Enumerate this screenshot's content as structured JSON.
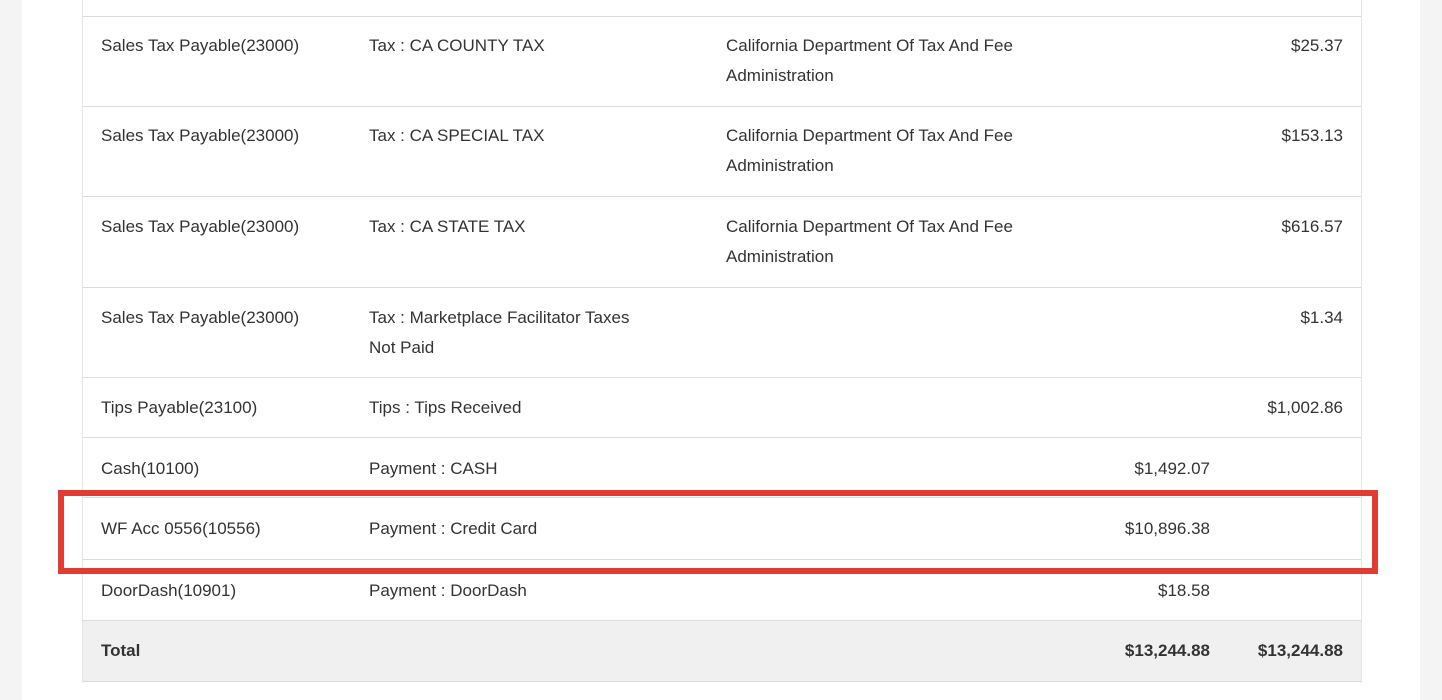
{
  "table": {
    "rows": [
      {
        "account": "Sales Tax Payable(23000)",
        "description": "Tax : CA COUNTY TAX",
        "vendor_line1": "California Department Of Tax And Fee",
        "vendor_line2": "Administration",
        "debit": "",
        "credit": "$25.37"
      },
      {
        "account": "Sales Tax Payable(23000)",
        "description": "Tax : CA SPECIAL TAX",
        "vendor_line1": "California Department Of Tax And Fee",
        "vendor_line2": "Administration",
        "debit": "",
        "credit": "$153.13"
      },
      {
        "account": "Sales Tax Payable(23000)",
        "description": "Tax : CA STATE TAX",
        "vendor_line1": "California Department Of Tax And Fee",
        "vendor_line2": "Administration",
        "debit": "",
        "credit": "$616.57"
      },
      {
        "account": "Sales Tax Payable(23000)",
        "description_line1": "Tax : Marketplace Facilitator Taxes",
        "description_line2": "Not Paid",
        "debit": "",
        "credit": "$1.34"
      },
      {
        "account": "Tips Payable(23100)",
        "description": "Tips : Tips Received",
        "debit": "",
        "credit": "$1,002.86"
      },
      {
        "account": "Cash(10100)",
        "description": "Payment : CASH",
        "debit": "$1,492.07",
        "credit": ""
      },
      {
        "account": "WF Acc 0556(10556)",
        "description": "Payment : Credit Card",
        "debit": "$10,896.38",
        "credit": ""
      },
      {
        "account": "DoorDash(10901)",
        "description": "Payment : DoorDash",
        "debit": "$18.58",
        "credit": ""
      }
    ],
    "total": {
      "label": "Total",
      "debit": "$13,244.88",
      "credit": "$13,244.88"
    }
  },
  "highlight_color": "#e03c31"
}
